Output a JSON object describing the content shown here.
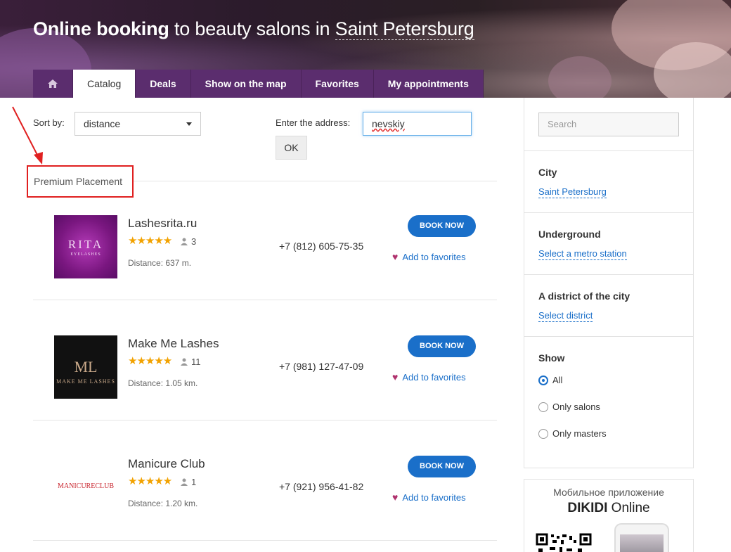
{
  "header": {
    "title_bold": "Online booking",
    "title_middle": " to beauty salons in ",
    "title_city": "Saint Petersburg"
  },
  "tabs": [
    {
      "label": "Catalog",
      "active": true
    },
    {
      "label": "Deals"
    },
    {
      "label": "Show on the map"
    },
    {
      "label": "Favorites"
    },
    {
      "label": "My appointments"
    }
  ],
  "controls": {
    "sort_label": "Sort by:",
    "sort_value": "distance",
    "address_label": "Enter the address:",
    "address_value": "nevskiy",
    "ok_label": "OK"
  },
  "section_label": "Premium Placement",
  "listings": [
    {
      "name": "Lashesrita.ru",
      "rating": 5,
      "reviews": "3",
      "distance": "Distance: 637 m.",
      "phone": "+7 (812) 605-75-35",
      "book": "BOOK NOW",
      "fav": "Add to favorites",
      "logo_text": "RITA",
      "logo_sub": "EYELASHES"
    },
    {
      "name": "Make Me Lashes",
      "rating": 5,
      "reviews": "11",
      "distance": "Distance: 1.05 km.",
      "phone": "+7 (981) 127-47-09",
      "book": "BOOK NOW",
      "fav": "Add to favorites",
      "logo_text": "MAKE ME LASHES",
      "logo_sub": "ML"
    },
    {
      "name": "Manicure Club",
      "rating": 5,
      "reviews": "1",
      "distance": "Distance: 1.20 km.",
      "phone": "+7 (921) 956-41-82",
      "book": "BOOK NOW",
      "fav": "Add to favorites",
      "logo_text": "MANICURECLUB",
      "logo_sub": ""
    }
  ],
  "sidebar": {
    "search_placeholder": "Search",
    "city_label": "City",
    "city_value": "Saint Petersburg",
    "underground_label": "Underground",
    "underground_link": "Select a metro station",
    "district_label": "A district of the city",
    "district_link": "Select district",
    "show_label": "Show",
    "show_options": [
      {
        "label": "All",
        "selected": true
      },
      {
        "label": "Only salons",
        "selected": false
      },
      {
        "label": "Only masters",
        "selected": false
      }
    ],
    "app_subtitle": "Мобильное приложение",
    "app_title_bold": "DIKIDI",
    "app_title_rest": " Online"
  },
  "colors": {
    "tab_bg": "#5b2d6e",
    "accent_blue": "#1a6fc9",
    "star": "#f2a200",
    "highlight_red": "#e02020",
    "heart": "#b0336e"
  }
}
